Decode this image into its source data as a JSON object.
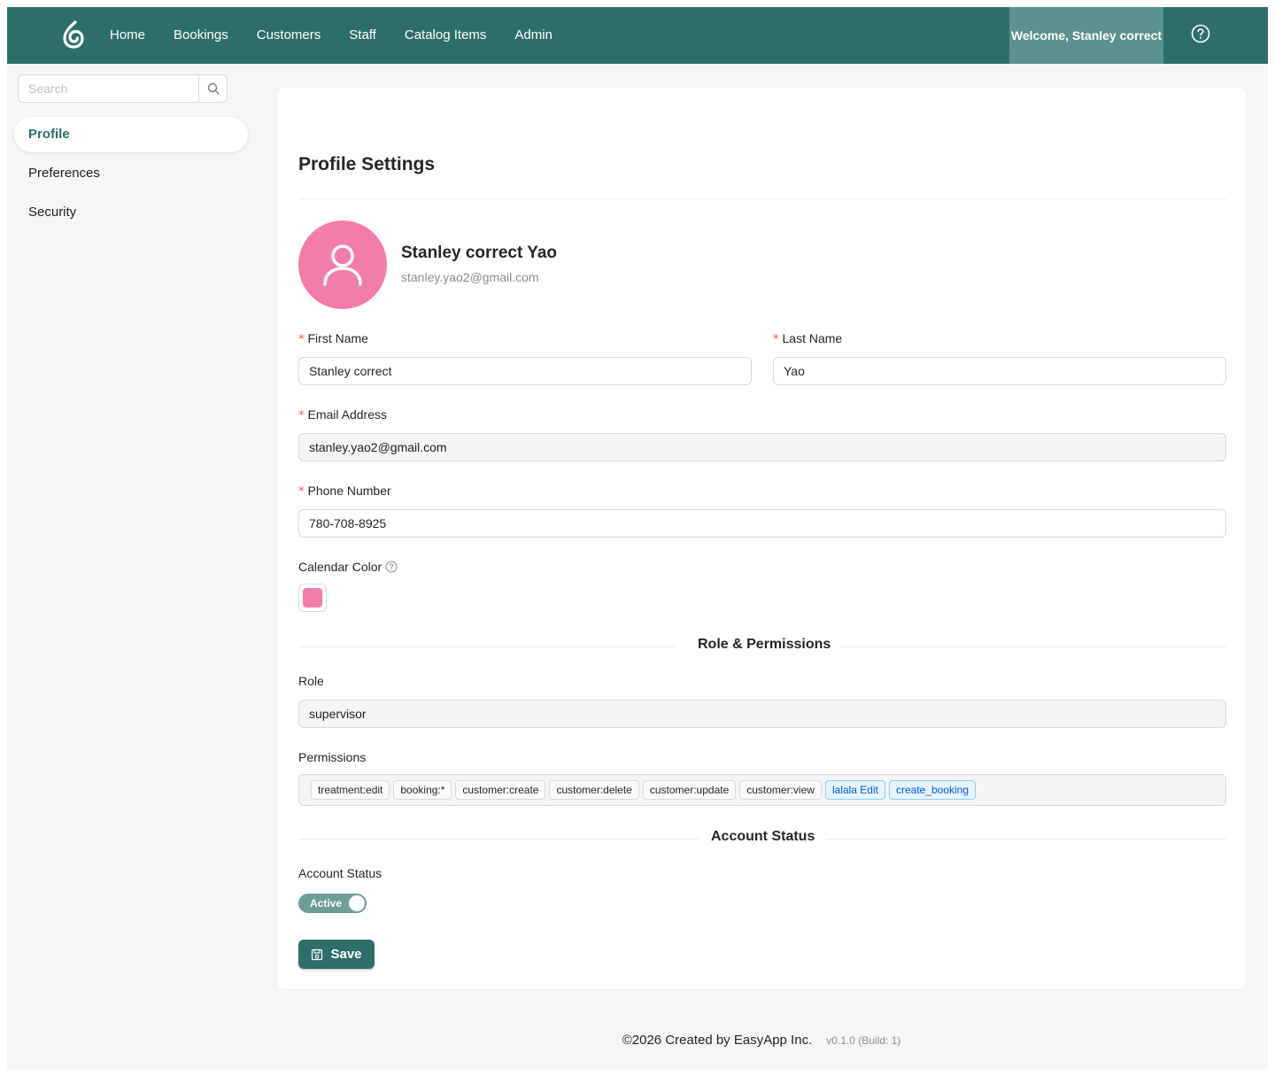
{
  "header": {
    "nav": [
      "Home",
      "Bookings",
      "Customers",
      "Staff",
      "Catalog Items",
      "Admin"
    ],
    "welcome": "Welcome, Stanley correct",
    "brand_color": "#2d6e6b"
  },
  "sidebar": {
    "search_placeholder": "Search",
    "items": [
      {
        "label": "Profile",
        "active": true
      },
      {
        "label": "Preferences",
        "active": false
      },
      {
        "label": "Security",
        "active": false
      }
    ]
  },
  "profile": {
    "title": "Profile Settings",
    "display_name": "Stanley correct Yao",
    "display_email": "stanley.yao2@gmail.com",
    "avatar_color": "#f37caa",
    "first_name_label": "First Name",
    "first_name": "Stanley correct",
    "last_name_label": "Last Name",
    "last_name": "Yao",
    "email_label": "Email Address",
    "email": "stanley.yao2@gmail.com",
    "phone_label": "Phone Number",
    "phone": "780-708-8925",
    "calendar_color_label": "Calendar Color",
    "calendar_color": "#f37caa"
  },
  "roles": {
    "section_title": "Role & Permissions",
    "role_label": "Role",
    "role": "supervisor",
    "permissions_label": "Permissions",
    "permissions": [
      {
        "label": "treatment:edit",
        "style": "default"
      },
      {
        "label": "booking:*",
        "style": "default"
      },
      {
        "label": "customer:create",
        "style": "default"
      },
      {
        "label": "customer:delete",
        "style": "default"
      },
      {
        "label": "customer:update",
        "style": "default"
      },
      {
        "label": "customer:view",
        "style": "default"
      },
      {
        "label": "lalala Edit",
        "style": "blue"
      },
      {
        "label": "create_booking",
        "style": "blue"
      }
    ]
  },
  "account": {
    "section_title": "Account Status",
    "status_label": "Account Status",
    "toggle_label": "Active",
    "toggle_on": true,
    "save_label": "Save"
  },
  "footer": {
    "copyright": "©2026 Created by EasyApp Inc.",
    "version": "v0.1.0 (Build: 1)"
  }
}
